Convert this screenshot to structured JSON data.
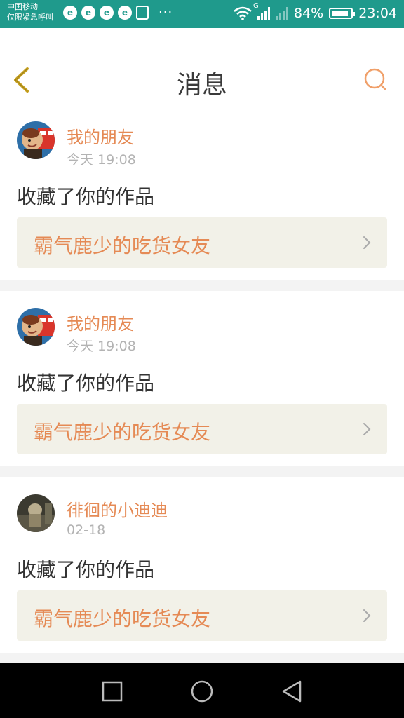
{
  "status_bar": {
    "carrier_line1": "中国移动",
    "carrier_line2": "仅限紧急呼叫",
    "more": "···",
    "network_type": "G",
    "battery": "84%",
    "time": "23:04",
    "background_color": "#1f9a8c"
  },
  "header": {
    "title": "消息",
    "back_icon": "chevron-left-icon",
    "search_icon": "search-icon",
    "accent_color": "#e58a55"
  },
  "messages": [
    {
      "user": "我的朋友",
      "time": "今天 19:08",
      "action": "收藏了你的作品",
      "work_title": "霸气鹿少的吃货女友"
    },
    {
      "user": "我的朋友",
      "time": "今天 19:08",
      "action": "收藏了你的作品",
      "work_title": "霸气鹿少的吃货女友"
    },
    {
      "user": "徘徊的小迪迪",
      "time": "02-18",
      "action": "收藏了你的作品",
      "work_title": "霸气鹿少的吃货女友"
    }
  ],
  "system_nav": {
    "icons": [
      "recents-square-icon",
      "home-circle-icon",
      "back-triangle-icon"
    ]
  }
}
